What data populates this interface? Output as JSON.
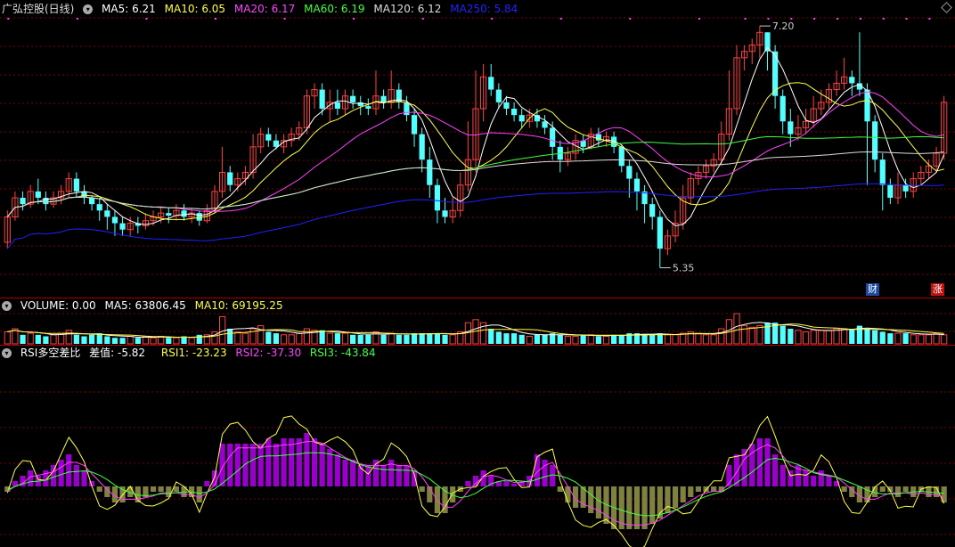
{
  "colors": {
    "up": "#ff4040",
    "down": "#54ffff",
    "ma5": "#ffffff",
    "ma10": "#ffff40",
    "ma20": "#ff40ff",
    "ma60": "#40ff40",
    "ma120": "#dcdcdc",
    "ma250": "#2020ff",
    "grid": "#7a0000",
    "hist_pos": "#9900cc",
    "hist_neg": "#808040"
  },
  "header_main": {
    "title": "广弘控股(日线)",
    "ma5": "MA5: 6.21",
    "ma10": "MA10: 6.05",
    "ma20": "MA20: 6.17",
    "ma60": "MA60: 6.19",
    "ma120": "MA120: 6.12",
    "ma250": "MA250: 5.84"
  },
  "header_volume": {
    "label": "VOLUME: 0.00",
    "ma5": "MA5: 63806.45",
    "ma10": "MA10: 69195.25"
  },
  "header_rsi": {
    "label": "RSI多空差比",
    "diff": "差值: -5.82",
    "rsi1": "RSI1: -23.23",
    "rsi2": "RSI2: -37.30",
    "rsi3": "RSI3: -43.84"
  },
  "badges": {
    "cai": "财",
    "zhang": "涨"
  },
  "chart_data": {
    "type": "candlestick",
    "price_range": [
      5.2,
      7.3
    ],
    "annotations": {
      "high": "7.20",
      "low": "5.35"
    },
    "candles": [
      [
        5.55,
        5.75,
        5.5,
        5.8
      ],
      [
        5.75,
        5.9,
        5.72,
        5.95
      ],
      [
        5.9,
        5.85,
        5.8,
        5.95
      ],
      [
        5.85,
        5.95,
        5.82,
        6.0
      ],
      [
        5.95,
        5.9,
        5.85,
        6.05
      ],
      [
        5.9,
        5.85,
        5.8,
        5.95
      ],
      [
        5.85,
        5.9,
        5.82,
        5.95
      ],
      [
        5.9,
        5.95,
        5.85,
        6.0
      ],
      [
        5.95,
        6.05,
        5.9,
        6.1
      ],
      [
        6.05,
        5.95,
        5.9,
        6.1
      ],
      [
        5.95,
        5.9,
        5.85,
        6.0
      ],
      [
        5.9,
        5.85,
        5.8,
        5.92
      ],
      [
        5.85,
        5.8,
        5.72,
        5.9
      ],
      [
        5.8,
        5.75,
        5.65,
        5.85
      ],
      [
        5.75,
        5.7,
        5.6,
        5.8
      ],
      [
        5.7,
        5.65,
        5.6,
        5.75
      ],
      [
        5.65,
        5.7,
        5.6,
        5.75
      ],
      [
        5.7,
        5.68,
        5.62,
        5.75
      ],
      [
        5.68,
        5.72,
        5.65,
        5.78
      ],
      [
        5.72,
        5.75,
        5.68,
        5.8
      ],
      [
        5.75,
        5.78,
        5.7,
        5.82
      ],
      [
        5.78,
        5.76,
        5.7,
        5.82
      ],
      [
        5.76,
        5.8,
        5.72,
        5.85
      ],
      [
        5.8,
        5.75,
        5.72,
        5.85
      ],
      [
        5.75,
        5.78,
        5.7,
        5.82
      ],
      [
        5.78,
        5.72,
        5.68,
        5.8
      ],
      [
        5.72,
        5.8,
        5.7,
        5.85
      ],
      [
        5.8,
        5.95,
        5.78,
        6.0
      ],
      [
        5.95,
        6.1,
        5.9,
        6.3
      ],
      [
        6.1,
        6.0,
        5.95,
        6.15
      ],
      [
        6.0,
        6.05,
        5.95,
        6.1
      ],
      [
        6.05,
        6.1,
        6.0,
        6.15
      ],
      [
        6.1,
        6.3,
        6.05,
        6.4
      ],
      [
        6.3,
        6.4,
        6.25,
        6.45
      ],
      [
        6.4,
        6.35,
        6.3,
        6.45
      ],
      [
        6.35,
        6.3,
        6.28,
        6.4
      ],
      [
        6.3,
        6.35,
        6.25,
        6.4
      ],
      [
        6.35,
        6.4,
        6.3,
        6.45
      ],
      [
        6.4,
        6.45,
        6.35,
        6.5
      ],
      [
        6.45,
        6.7,
        6.4,
        6.75
      ],
      [
        6.7,
        6.75,
        6.6,
        6.8
      ],
      [
        6.75,
        6.6,
        6.55,
        6.8
      ],
      [
        6.6,
        6.65,
        6.5,
        6.75
      ],
      [
        6.65,
        6.6,
        6.55,
        6.75
      ],
      [
        6.6,
        6.7,
        6.55,
        6.75
      ],
      [
        6.7,
        6.65,
        6.6,
        6.75
      ],
      [
        6.65,
        6.62,
        6.55,
        6.7
      ],
      [
        6.62,
        6.6,
        6.55,
        6.68
      ],
      [
        6.6,
        6.7,
        6.55,
        6.9
      ],
      [
        6.7,
        6.65,
        6.6,
        6.75
      ],
      [
        6.65,
        6.75,
        6.6,
        6.9
      ],
      [
        6.75,
        6.65,
        6.6,
        6.8
      ],
      [
        6.65,
        6.55,
        6.5,
        6.7
      ],
      [
        6.55,
        6.4,
        6.3,
        6.6
      ],
      [
        6.4,
        6.2,
        6.1,
        6.45
      ],
      [
        6.2,
        6.0,
        5.9,
        6.3
      ],
      [
        6.0,
        5.8,
        5.7,
        6.05
      ],
      [
        5.8,
        5.75,
        5.7,
        5.9
      ],
      [
        5.75,
        5.8,
        5.7,
        5.9
      ],
      [
        5.8,
        6.0,
        5.75,
        6.1
      ],
      [
        6.0,
        6.2,
        5.95,
        6.5
      ],
      [
        6.2,
        6.6,
        6.1,
        6.9
      ],
      [
        6.6,
        6.85,
        6.5,
        6.95
      ],
      [
        6.85,
        6.75,
        6.7,
        6.95
      ],
      [
        6.75,
        6.65,
        6.6,
        6.8
      ],
      [
        6.65,
        6.6,
        6.55,
        6.7
      ],
      [
        6.6,
        6.55,
        6.5,
        6.65
      ],
      [
        6.55,
        6.5,
        6.45,
        6.6
      ],
      [
        6.5,
        6.55,
        6.45,
        6.6
      ],
      [
        6.55,
        6.5,
        6.45,
        6.6
      ],
      [
        6.5,
        6.45,
        6.4,
        6.55
      ],
      [
        6.45,
        6.3,
        6.2,
        6.5
      ],
      [
        6.3,
        6.2,
        6.1,
        6.35
      ],
      [
        6.2,
        6.25,
        6.15,
        6.3
      ],
      [
        6.25,
        6.35,
        6.2,
        6.4
      ],
      [
        6.35,
        6.3,
        6.25,
        6.4
      ],
      [
        6.3,
        6.4,
        6.28,
        6.45
      ],
      [
        6.4,
        6.35,
        6.3,
        6.45
      ],
      [
        6.35,
        6.38,
        6.3,
        6.42
      ],
      [
        6.38,
        6.3,
        6.25,
        6.42
      ],
      [
        6.3,
        6.15,
        6.1,
        6.32
      ],
      [
        6.15,
        6.05,
        5.9,
        6.2
      ],
      [
        6.05,
        5.95,
        5.8,
        6.1
      ],
      [
        5.95,
        5.85,
        5.7,
        6.0
      ],
      [
        5.85,
        5.75,
        5.65,
        5.9
      ],
      [
        5.75,
        5.5,
        5.35,
        5.8
      ],
      [
        5.5,
        5.6,
        5.45,
        5.65
      ],
      [
        5.6,
        5.7,
        5.55,
        5.8
      ],
      [
        5.7,
        5.9,
        5.65,
        6.0
      ],
      [
        5.9,
        6.05,
        5.85,
        6.1
      ],
      [
        6.05,
        6.1,
        6.0,
        6.15
      ],
      [
        6.1,
        6.15,
        6.05,
        6.2
      ],
      [
        6.15,
        6.2,
        6.1,
        6.25
      ],
      [
        6.2,
        6.4,
        6.15,
        6.5
      ],
      [
        6.4,
        6.6,
        6.35,
        6.9
      ],
      [
        6.6,
        7.0,
        6.55,
        7.1
      ],
      [
        7.0,
        7.05,
        6.9,
        7.1
      ],
      [
        7.05,
        7.1,
        6.95,
        7.15
      ],
      [
        7.1,
        7.2,
        7.0,
        7.25
      ],
      [
        7.2,
        7.05,
        6.9,
        7.2
      ],
      [
        7.05,
        6.7,
        6.6,
        7.1
      ],
      [
        6.7,
        6.5,
        6.4,
        6.75
      ],
      [
        6.5,
        6.4,
        6.3,
        6.6
      ],
      [
        6.4,
        6.45,
        6.35,
        6.55
      ],
      [
        6.45,
        6.5,
        6.4,
        6.6
      ],
      [
        6.5,
        6.6,
        6.45,
        6.7
      ],
      [
        6.6,
        6.65,
        6.55,
        6.75
      ],
      [
        6.65,
        6.75,
        6.6,
        6.8
      ],
      [
        6.75,
        6.8,
        6.7,
        6.9
      ],
      [
        6.8,
        6.85,
        6.75,
        7.0
      ],
      [
        6.85,
        6.8,
        6.7,
        6.9
      ],
      [
        6.8,
        6.75,
        6.7,
        7.2
      ],
      [
        6.75,
        6.5,
        6.0,
        6.8
      ],
      [
        6.5,
        6.2,
        6.1,
        6.55
      ],
      [
        6.2,
        6.0,
        5.8,
        6.25
      ],
      [
        6.0,
        5.9,
        5.85,
        6.05
      ],
      [
        5.9,
        6.0,
        5.85,
        6.1
      ],
      [
        6.0,
        5.95,
        5.9,
        6.05
      ],
      [
        5.95,
        6.05,
        5.9,
        6.1
      ],
      [
        6.05,
        6.1,
        6.0,
        6.15
      ],
      [
        6.1,
        6.15,
        6.05,
        6.2
      ],
      [
        6.15,
        6.25,
        6.1,
        6.3
      ],
      [
        6.25,
        6.65,
        6.2,
        6.7
      ]
    ],
    "volumes": [
      0.4,
      0.5,
      0.3,
      0.35,
      0.3,
      0.25,
      0.3,
      0.35,
      0.45,
      0.3,
      0.25,
      0.3,
      0.35,
      0.25,
      0.2,
      0.2,
      0.25,
      0.2,
      0.25,
      0.2,
      0.25,
      0.2,
      0.2,
      0.25,
      0.2,
      0.3,
      0.3,
      0.4,
      0.9,
      0.5,
      0.4,
      0.35,
      0.5,
      0.6,
      0.4,
      0.35,
      0.3,
      0.3,
      0.35,
      0.5,
      0.45,
      0.45,
      0.35,
      0.35,
      0.35,
      0.3,
      0.3,
      0.3,
      0.4,
      0.3,
      0.35,
      0.3,
      0.3,
      0.35,
      0.35,
      0.35,
      0.35,
      0.3,
      0.3,
      0.4,
      0.7,
      0.8,
      0.7,
      0.5,
      0.4,
      0.35,
      0.35,
      0.3,
      0.25,
      0.3,
      0.3,
      0.35,
      0.3,
      0.25,
      0.25,
      0.3,
      0.3,
      0.25,
      0.25,
      0.3,
      0.3,
      0.35,
      0.35,
      0.3,
      0.3,
      0.35,
      0.3,
      0.3,
      0.35,
      0.4,
      0.35,
      0.3,
      0.3,
      0.5,
      0.8,
      1.0,
      0.6,
      0.55,
      0.6,
      0.7,
      0.7,
      0.6,
      0.5,
      0.45,
      0.4,
      0.45,
      0.45,
      0.45,
      0.5,
      0.5,
      0.5,
      0.6,
      0.5,
      0.45,
      0.4,
      0.35,
      0.35,
      0.35,
      0.3,
      0.3,
      0.3,
      0.35,
      0.3
    ],
    "rsi_diff": [
      -0.1,
      0.1,
      0.2,
      0.3,
      0.2,
      0.3,
      0.4,
      0.5,
      0.6,
      0.4,
      0.3,
      0.1,
      -0.1,
      -0.2,
      -0.3,
      -0.3,
      -0.2,
      -0.3,
      -0.2,
      -0.1,
      -0.1,
      -0.2,
      -0.1,
      -0.2,
      -0.2,
      -0.3,
      0.1,
      0.3,
      0.8,
      0.8,
      0.8,
      0.8,
      0.8,
      0.8,
      0.9,
      0.8,
      0.9,
      0.9,
      0.9,
      1.0,
      0.9,
      0.8,
      0.7,
      0.6,
      0.5,
      0.5,
      0.4,
      0.4,
      0.5,
      0.4,
      0.5,
      0.4,
      0.4,
      0.3,
      -0.1,
      -0.3,
      -0.5,
      -0.5,
      -0.3,
      -0.1,
      0.1,
      0.2,
      0.3,
      0.2,
      0.1,
      0.1,
      0.05,
      0.1,
      0.2,
      0.6,
      0.5,
      0.4,
      -0.1,
      -0.3,
      -0.4,
      -0.4,
      -0.5,
      -0.6,
      -0.7,
      -0.8,
      -0.8,
      -0.8,
      -0.8,
      -0.8,
      -0.7,
      -0.6,
      -0.5,
      -0.4,
      -0.3,
      -0.2,
      -0.1,
      -0.1,
      -0.1,
      -0.1,
      0.4,
      0.6,
      0.7,
      0.8,
      0.9,
      0.9,
      0.6,
      0.4,
      0.3,
      0.4,
      0.3,
      0.2,
      0.3,
      0.2,
      0.1,
      -0.1,
      -0.2,
      -0.3,
      -0.3,
      -0.2,
      -0.1,
      -0.1,
      -0.2,
      -0.1,
      -0.2,
      -0.1,
      -0.2,
      -0.2,
      -0.3
    ]
  }
}
